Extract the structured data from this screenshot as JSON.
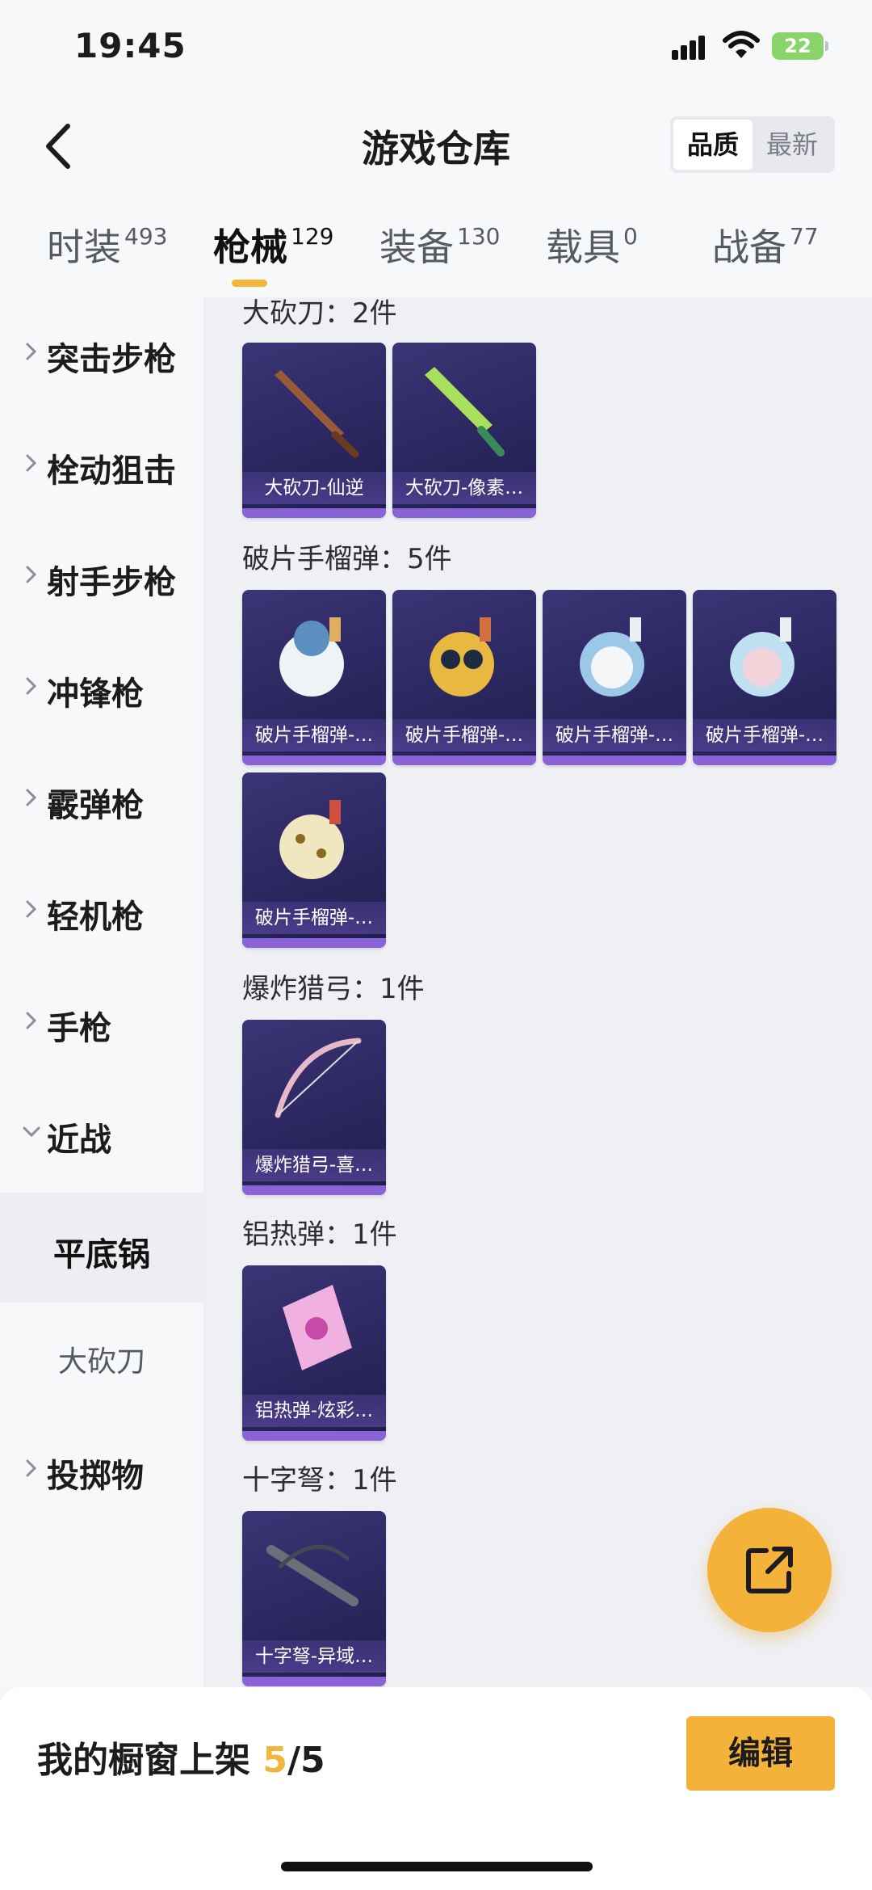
{
  "status": {
    "time": "19:45",
    "battery": "22"
  },
  "header": {
    "title": "游戏仓库",
    "sort_options": [
      "品质",
      "最新"
    ]
  },
  "tabs": [
    {
      "label": "时装",
      "count": "493"
    },
    {
      "label": "枪械",
      "count": "129"
    },
    {
      "label": "装备",
      "count": "130"
    },
    {
      "label": "载具",
      "count": "0"
    },
    {
      "label": "战备",
      "count": "77"
    }
  ],
  "sidebar": {
    "items": [
      "突击步枪",
      "栓动狙击",
      "射手步枪",
      "冲锋枪",
      "霰弹枪",
      "轻机枪",
      "手枪",
      "近战"
    ],
    "subitems": [
      "平底锅",
      "大砍刀"
    ],
    "last": "投掷物"
  },
  "groups": [
    {
      "title": "大砍刀：2件",
      "items": [
        "大砍刀-仙逆",
        "大砍刀-像素…"
      ]
    },
    {
      "title": "破片手榴弹：5件",
      "items": [
        "破片手榴弹-…",
        "破片手榴弹-…",
        "破片手榴弹-…",
        "破片手榴弹-…",
        "破片手榴弹-…"
      ]
    },
    {
      "title": "爆炸猎弓：1件",
      "items": [
        "爆炸猎弓-喜…"
      ]
    },
    {
      "title": "铝热弹：1件",
      "items": [
        "铝热弹-炫彩…"
      ]
    },
    {
      "title": "十字弩：1件",
      "items": [
        "十字弩-异域…"
      ]
    }
  ],
  "footer": {
    "shelf_label": "我的橱窗上架 ",
    "shelf_count": "5",
    "shelf_total": "/5",
    "edit_label": "编辑"
  },
  "colors": {
    "accent": "#f4b23a",
    "card_bg": "#2b2760",
    "card_bar": "#8b63d8"
  },
  "icons": {
    "back": "chevron-left-icon",
    "fab": "share-out-icon",
    "signal": "signal-icon",
    "wifi": "wifi-icon",
    "battery": "battery-icon"
  }
}
